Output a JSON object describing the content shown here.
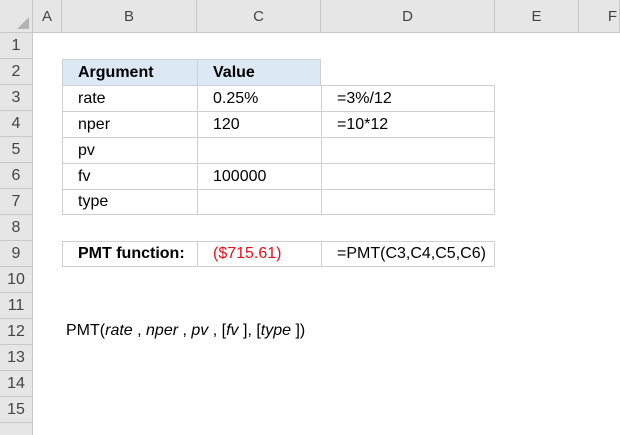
{
  "columns": [
    "A",
    "B",
    "C",
    "D",
    "E",
    "F"
  ],
  "rows": [
    "1",
    "2",
    "3",
    "4",
    "5",
    "6",
    "7",
    "8",
    "9",
    "10",
    "11",
    "12",
    "13",
    "14",
    "15"
  ],
  "table": {
    "header": {
      "argument": "Argument",
      "value": "Value"
    },
    "rows": [
      {
        "argument": "rate",
        "value": "0.25%",
        "formula": "=3%/12"
      },
      {
        "argument": "nper",
        "value": "120",
        "formula": "=10*12"
      },
      {
        "argument": "pv",
        "value": "",
        "formula": ""
      },
      {
        "argument": "fv",
        "value": "100000",
        "formula": ""
      },
      {
        "argument": "type",
        "value": "",
        "formula": ""
      }
    ]
  },
  "pmt": {
    "label": "PMT function:",
    "value": "($715.61)",
    "formula": "=PMT(C3,C4,C5,C6)"
  },
  "syntax": {
    "fn": "PMT(",
    "rate": "rate",
    "sep1": " , ",
    "nper": "nper",
    "sep2": " , ",
    "pv": "pv",
    "sep3": " , [",
    "fv": "fv",
    "sep4": " ], [",
    "type": "type",
    "end": " ])"
  },
  "colors": {
    "header_bg": "#e6e6e6",
    "highlight": "#dce9f5",
    "negative": "#e8101a"
  }
}
